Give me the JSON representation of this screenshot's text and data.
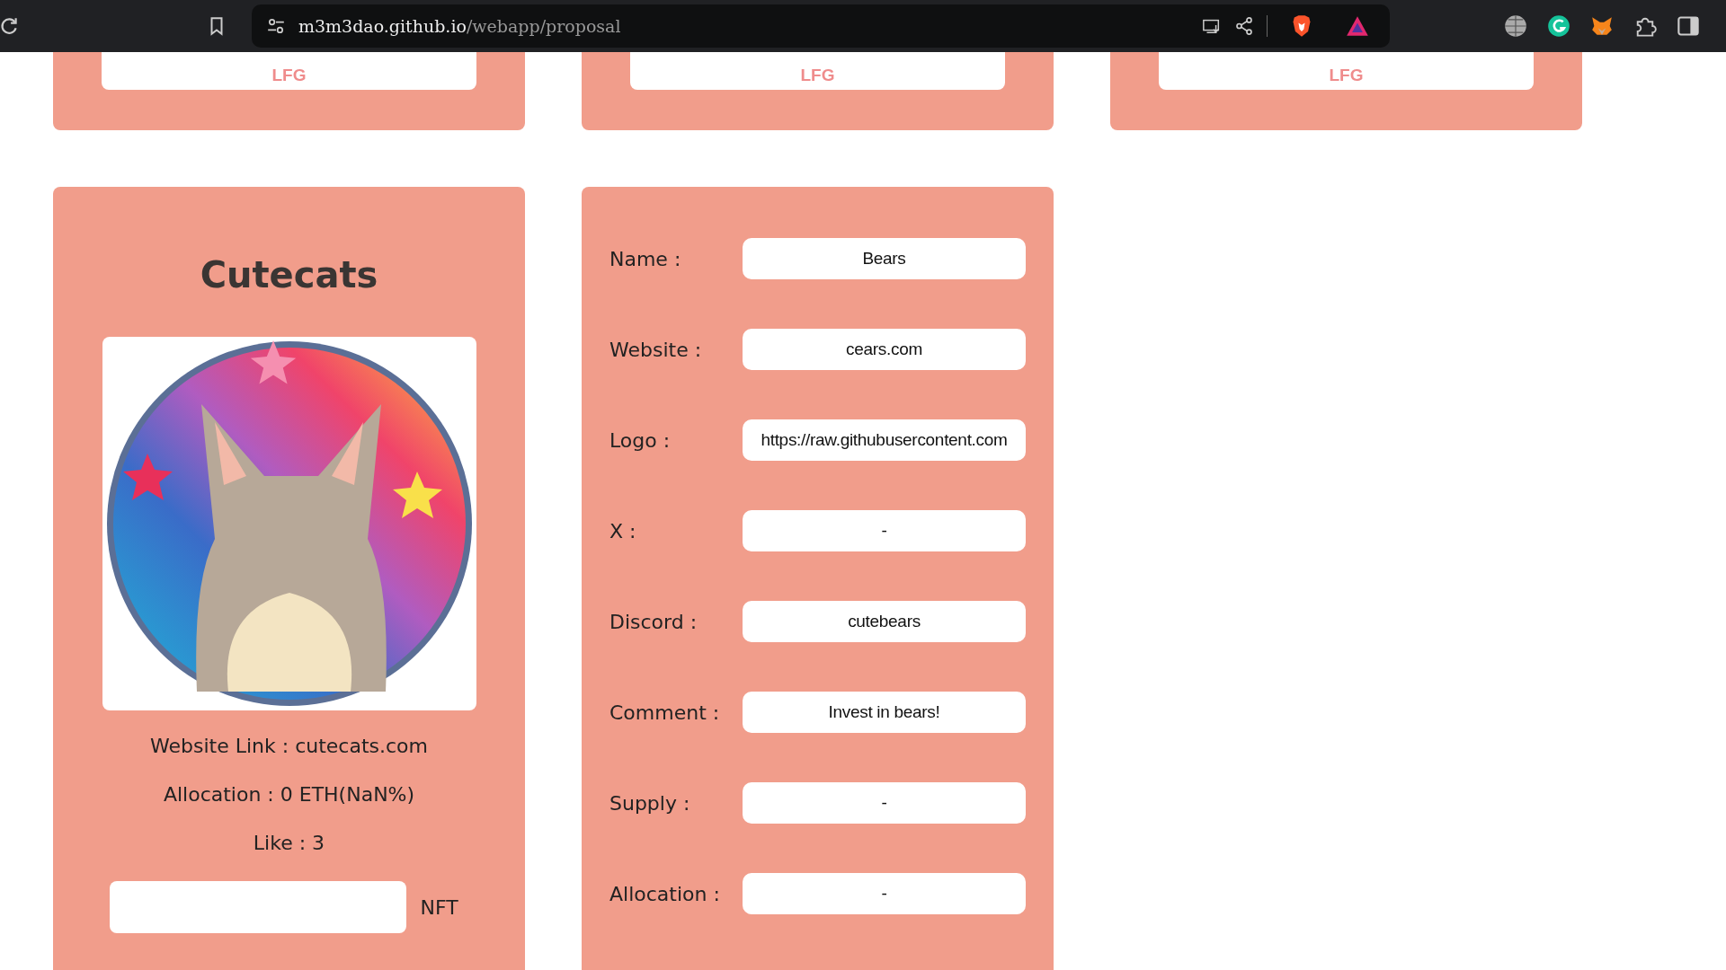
{
  "browser": {
    "url_host": "m3m3dao.github.io",
    "url_path": "/webapp/proposal"
  },
  "top_cards": [
    {
      "button": "LFG"
    },
    {
      "button": "LFG"
    },
    {
      "button": "LFG"
    }
  ],
  "project_card": {
    "title": "Cutecats",
    "website_link": "Website Link : cutecats.com",
    "allocation": "Allocation : 0 ETH(NaN%)",
    "likes": "Like : 3",
    "nft_unit": "NFT"
  },
  "proposal_form": {
    "fields": [
      {
        "label": "Name :",
        "value": "Bears"
      },
      {
        "label": "Website :",
        "value": "cears.com"
      },
      {
        "label": "Logo :",
        "value": "https://raw.githubusercontent.com"
      },
      {
        "label": "X :",
        "value": "-"
      },
      {
        "label": "Discord :",
        "value": "cutebears"
      },
      {
        "label": "Comment :",
        "value": "Invest in bears!"
      },
      {
        "label": "Supply :",
        "value": "-"
      },
      {
        "label": "Allocation :",
        "value": "-"
      }
    ]
  }
}
